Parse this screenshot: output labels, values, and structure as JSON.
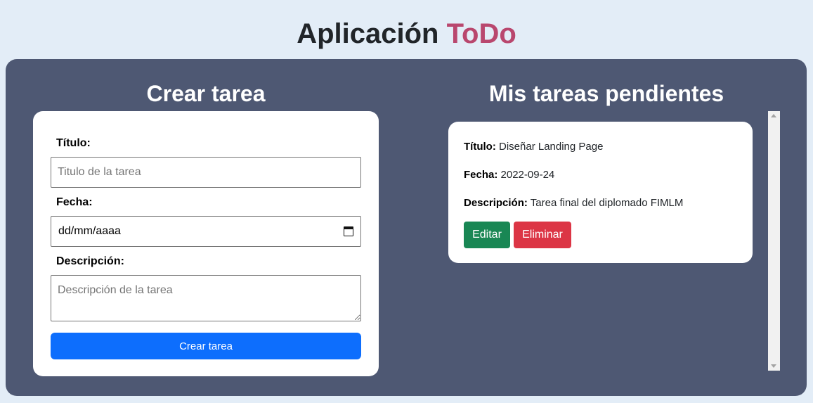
{
  "header": {
    "title_main": "Aplicación",
    "title_accent": "ToDo"
  },
  "form": {
    "heading": "Crear tarea",
    "titulo_label": "Título:",
    "titulo_placeholder": "Titulo de la tarea",
    "fecha_label": "Fecha:",
    "fecha_value": "dd/mm/aaaa",
    "descripcion_label": "Descripción:",
    "descripcion_placeholder": "Descripción de la tarea",
    "submit_label": "Crear tarea"
  },
  "tasks": {
    "heading": "Mis tareas pendientes",
    "items": [
      {
        "titulo_label": "Título:",
        "titulo": "Diseñar Landing Page",
        "fecha_label": "Fecha:",
        "fecha": "2022-09-24",
        "descripcion_label": "Descripción:",
        "descripcion": "Tarea final del diplomado FIMLM",
        "edit_label": "Editar",
        "delete_label": "Eliminar"
      }
    ]
  },
  "colors": {
    "accent": "#b9476e",
    "panel": "#4e5873",
    "primary": "#0d6efd",
    "success": "#198754",
    "danger": "#dc3545"
  }
}
